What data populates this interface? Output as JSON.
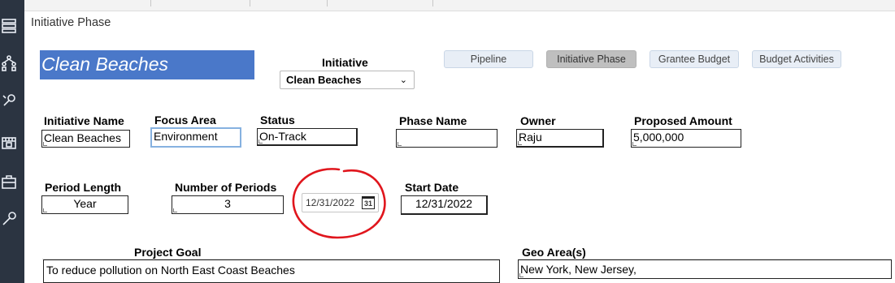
{
  "page": {
    "title": "Initiative Phase"
  },
  "banner": {
    "text": "Clean Beaches"
  },
  "initiative": {
    "label": "Initiative",
    "selected": "Clean Beaches"
  },
  "tabs": [
    "Pipeline",
    "Initiative Phase",
    "Grantee Budget",
    "Budget Activities"
  ],
  "active_tab": "Initiative Phase",
  "fields": {
    "initiative_name": {
      "label": "Initiative Name",
      "value": "Clean Beaches"
    },
    "focus_area": {
      "label": "Focus Area",
      "value": "Environment"
    },
    "status": {
      "label": "Status",
      "value": "On-Track"
    },
    "phase_name": {
      "label": "Phase Name",
      "value": ""
    },
    "owner": {
      "label": "Owner",
      "value": "Raju"
    },
    "proposed_amount": {
      "label": "Proposed Amount",
      "value": "5,000,000"
    },
    "period_length": {
      "label": "Period Length",
      "value": "Year"
    },
    "number_of_periods": {
      "label": "Number of Periods",
      "value": "3"
    },
    "date_picker": {
      "value": "12/31/2022",
      "icon_text": "31"
    },
    "start_date": {
      "label": "Start Date",
      "value": "12/31/2022"
    },
    "project_goal": {
      "label": "Project Goal",
      "value": "To reduce pollution on North East Coast Beaches"
    },
    "geo_area": {
      "label": "Geo Area(s)",
      "value": "New York, New Jersey,"
    }
  },
  "icons": {
    "rail": [
      "list-icon",
      "hierarchy-icon",
      "tools-icon",
      "film-icon",
      "briefcase-icon",
      "wrench-icon"
    ],
    "calendar": "calendar-icon",
    "chevron": "chevron-down-icon"
  },
  "colors": {
    "banner_bg": "#4a78c9",
    "tab_bg": "#e8eef6",
    "tab_active_bg": "#bfbfbf",
    "rail_bg": "#2b3441",
    "annotation": "#e0161d"
  }
}
